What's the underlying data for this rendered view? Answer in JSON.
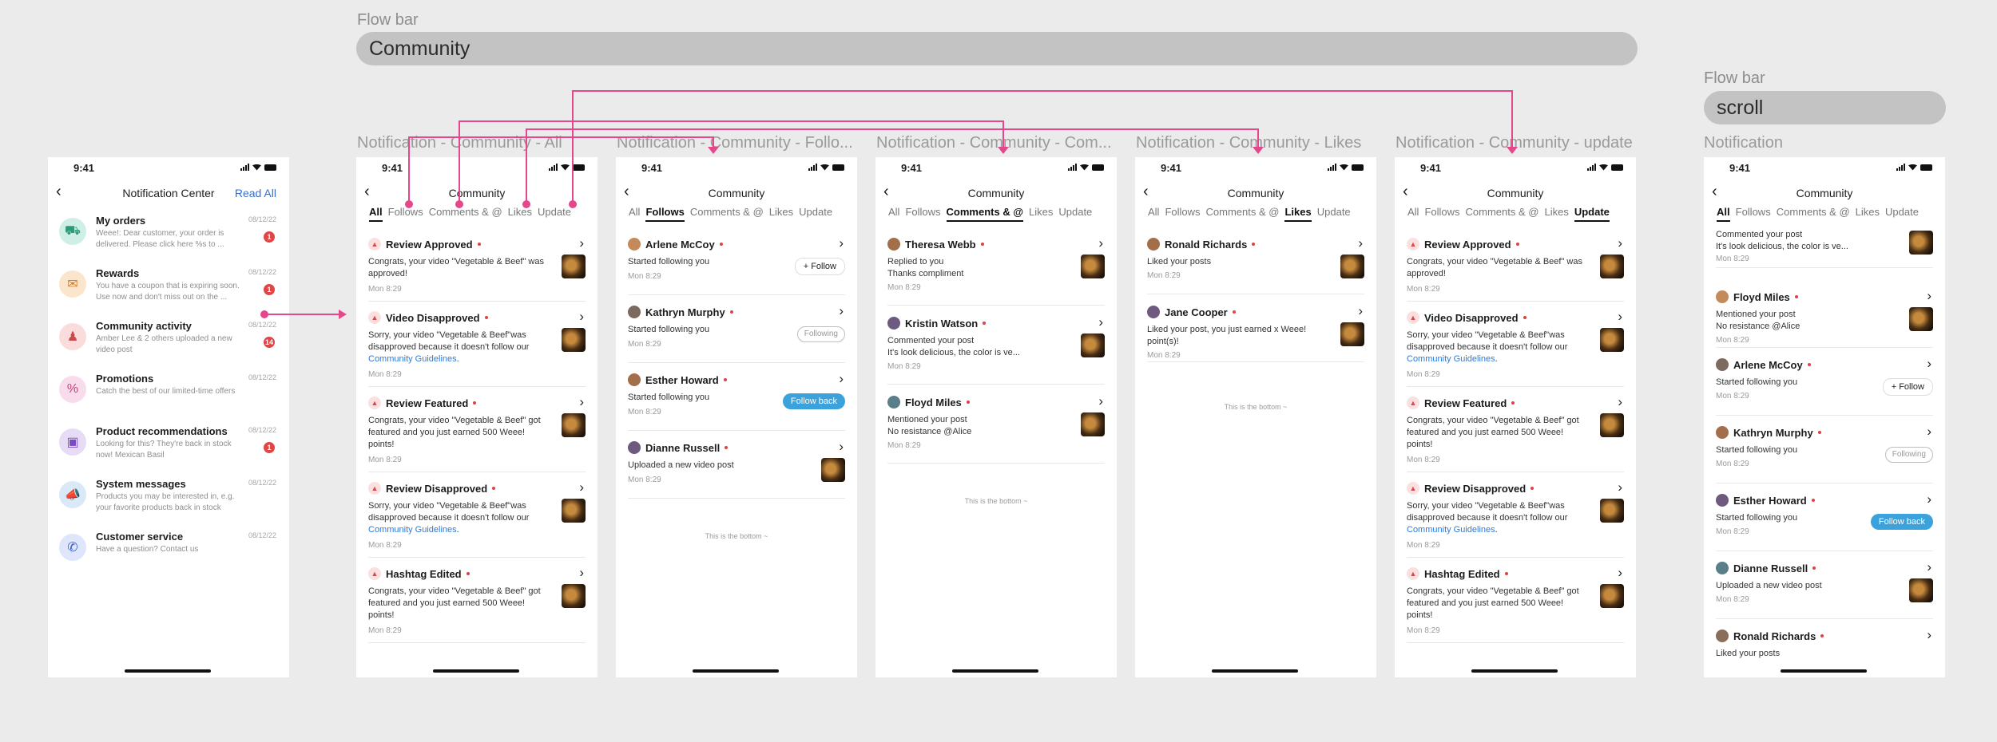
{
  "flow_bars": [
    {
      "label": "Flow bar",
      "value": "Community"
    },
    {
      "label": "Flow bar",
      "value": "scroll"
    }
  ],
  "frames": [
    "Notification - Community - All",
    "Notification - Community - Follo...",
    "Notification - Community - Com...",
    "Notification - Community - Likes",
    "Notification - Community - update",
    "Notification"
  ],
  "status_time": "9:41",
  "notification_center": {
    "back": "‹",
    "title": "Notification Center",
    "read_all": "Read All",
    "items": [
      {
        "title": "My orders",
        "date": "08/12/22",
        "subtitle": "Weee!: Dear customer, your order is delivered. Please click here %s to ...",
        "badge": "1",
        "icon": "truck-icon",
        "bg": "#cfeee5"
      },
      {
        "title": "Rewards",
        "date": "08/12/22",
        "subtitle": "You have a coupon that is expiring soon. Use now and don't miss out on the ...",
        "badge": "1",
        "icon": "coupon-icon",
        "bg": "#fbe5cd"
      },
      {
        "title": "Community activity",
        "date": "08/12/22",
        "subtitle": "Amber Lee & 2 others uploaded a new video post",
        "badge": "14",
        "icon": "people-icon",
        "bg": "#fbdcdc"
      },
      {
        "title": "Promotions",
        "date": "08/12/22",
        "subtitle": "Catch the best of our limited-time offers",
        "badge": "",
        "icon": "percent-icon",
        "bg": "#f9dcec"
      },
      {
        "title": "Product recommendations",
        "date": "08/12/22",
        "subtitle": "Looking for this? They're back in stock now! Mexican Basil",
        "badge": "1",
        "icon": "bag-icon",
        "bg": "#e7dcf5"
      },
      {
        "title": "System messages",
        "date": "08/12/22",
        "subtitle": "Products you may be interested in, e.g. your favorite products back in stock",
        "badge": "",
        "icon": "megaphone-icon",
        "bg": "#d9e9f7"
      },
      {
        "title": "Customer service",
        "date": "08/12/22",
        "subtitle": "Have a question? Contact us",
        "badge": "",
        "icon": "phone-icon",
        "bg": "#dfe6fb"
      }
    ]
  },
  "community": {
    "title": "Community",
    "tabs": [
      "All",
      "Follows",
      "Comments & @",
      "Likes",
      "Update"
    ],
    "bottom": "This is the bottom ~"
  },
  "all_cards": [
    {
      "title": "Review Approved",
      "lines": [
        "Congrats, your video \"Vegetable & Beef\" was",
        "approved!"
      ],
      "link": "",
      "time": "Mon 8:29"
    },
    {
      "title": "Video Disapproved",
      "lines": [
        "Sorry, your video \"Vegetable & Beef\"was",
        "disapproved because it doesn't follow our"
      ],
      "link": "Community Guidelines",
      "time": "Mon 8:29"
    },
    {
      "title": "Review Featured",
      "lines": [
        "Congrats, your video \"Vegetable & Beef\" got",
        "featured and you just earned 500 Weee!",
        "points!"
      ],
      "link": "",
      "time": "Mon 8:29"
    },
    {
      "title": "Review Disapproved",
      "lines": [
        "Sorry, your video \"Vegetable & Beef\"was",
        "disapproved because it doesn't follow our"
      ],
      "link": "Community Guidelines",
      "time": "Mon 8:29"
    },
    {
      "title": "Hashtag Edited",
      "lines": [
        "Congrats, your video \"Vegetable & Beef\" got",
        "featured and you just earned 500 Weee!",
        "points!"
      ],
      "link": "",
      "time": "Mon 8:29"
    }
  ],
  "follows_cards": [
    {
      "name": "Arlene McCoy",
      "text": "Started following you",
      "time": "Mon 8:29",
      "action": "+ Follow"
    },
    {
      "name": "Kathryn Murphy",
      "text": "Started following you",
      "time": "Mon 8:29",
      "action": "Following"
    },
    {
      "name": "Esther Howard",
      "text": "Started following you",
      "time": "Mon 8:29",
      "action": "Follow back"
    },
    {
      "name": "Dianne Russell",
      "text": "Uploaded a new video post",
      "time": "Mon 8:29",
      "action": ""
    }
  ],
  "comments_cards": [
    {
      "name": "Theresa Webb",
      "lines": [
        "Replied to you",
        "Thanks compliment"
      ],
      "time": "Mon 8:29"
    },
    {
      "name": "Kristin Watson",
      "lines": [
        "Commented your post",
        "It's look delicious, the color is ve..."
      ],
      "time": "Mon 8:29"
    },
    {
      "name": "Floyd Miles",
      "lines": [
        "Mentioned your post",
        "No resistance @Alice"
      ],
      "time": "Mon 8:29"
    }
  ],
  "likes_cards": [
    {
      "name": "Ronald Richards",
      "lines": [
        "Liked your posts"
      ],
      "time": "Mon 8:29"
    },
    {
      "name": "Jane Cooper",
      "lines": [
        "Liked your post, you just earned x Weee!",
        "point(s)!"
      ],
      "time": "Mon 8:29"
    }
  ],
  "scroll_screen": {
    "top_lines": [
      "Commented your post",
      "It's look delicious, the color is ve..."
    ],
    "top_time": "Mon 8:29",
    "cards": [
      {
        "name": "Floyd Miles",
        "lines": [
          "Mentioned your post",
          "No resistance @Alice"
        ],
        "time": "Mon 8:29",
        "action": "thumb"
      },
      {
        "name": "Arlene McCoy",
        "lines": [
          "Started following you"
        ],
        "time": "Mon 8:29",
        "action": "+ Follow"
      },
      {
        "name": "Kathryn Murphy",
        "lines": [
          "Started following you"
        ],
        "time": "Mon 8:29",
        "action": "Following"
      },
      {
        "name": "Esther Howard",
        "lines": [
          "Started following you"
        ],
        "time": "Mon 8:29",
        "action": "Follow back"
      },
      {
        "name": "Dianne Russell",
        "lines": [
          "Uploaded a new video post"
        ],
        "time": "Mon 8:29",
        "action": "thumb"
      },
      {
        "name": "Ronald Richards",
        "lines": [
          "Liked your posts"
        ],
        "time": "",
        "action": ""
      }
    ]
  },
  "colors": {
    "accent_blue": "#2f6fd6",
    "badge_red": "#e14545",
    "flow_pink": "#e6478c",
    "follow_back": "#3ba2dc"
  }
}
